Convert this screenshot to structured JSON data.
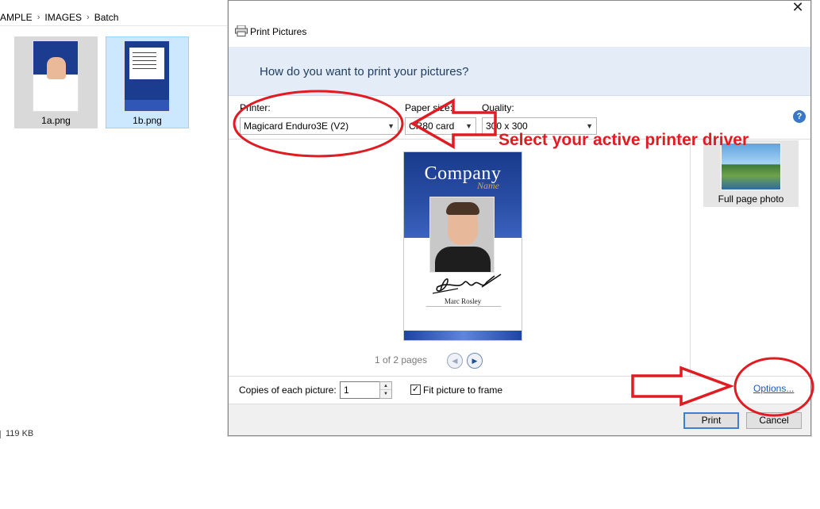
{
  "explorer": {
    "breadcrumb": [
      "AMPLE",
      "IMAGES",
      "Batch"
    ],
    "files": [
      {
        "name": "1a.png"
      },
      {
        "name": "1b.png"
      }
    ],
    "status_text": "119 KB"
  },
  "dialog": {
    "title": "Print Pictures",
    "close_glyph": "✕",
    "banner_text": "How do you want to print your pictures?",
    "printer_label": "Printer:",
    "printer_value": "Magicard Enduro3E (V2)",
    "paper_size_label": "Paper size:",
    "paper_size_value": "CR80 card",
    "quality_label": "Quality:",
    "quality_value": "300 x 300",
    "help_glyph": "?",
    "preview": {
      "card_company": "Company",
      "card_company_sub": "Name",
      "card_person_name": "Marc Rosley",
      "pages_text": "1 of 2 pages",
      "prev_glyph": "◀",
      "next_glyph": "▶"
    },
    "layout_label": "Full page photo",
    "copies_label": "Copies of each picture:",
    "copies_value": "1",
    "fit_label": "Fit picture to frame",
    "fit_checked_glyph": "✓",
    "options_link": "Options...",
    "print_button": "Print",
    "cancel_button": "Cancel"
  },
  "annotation": {
    "text": "Select your active printer driver",
    "color": "#e11b22"
  },
  "icons": [
    "chevron-right-icon",
    "printer-icon",
    "close-icon",
    "chevron-down-icon",
    "help-icon",
    "prev-page-icon",
    "next-page-icon",
    "spin-up-icon",
    "spin-down-icon",
    "checkbox-checked-icon"
  ]
}
